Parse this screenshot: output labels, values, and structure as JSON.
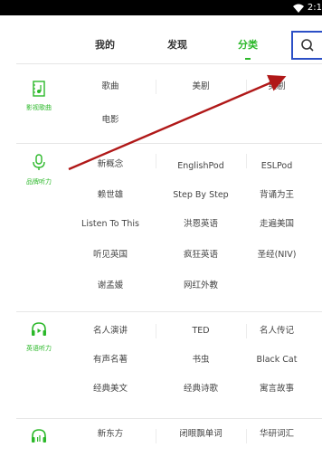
{
  "status": {
    "time": "2:1"
  },
  "tabs": [
    {
      "label": "我的"
    },
    {
      "label": "发现"
    },
    {
      "label": "分类"
    }
  ],
  "sections": [
    {
      "label": "影视歌曲",
      "icon": "film-music-icon",
      "items": [
        "歌曲",
        "美剧",
        "英剧",
        "电影"
      ]
    },
    {
      "label": "品牌听力",
      "icon": "microphone-icon",
      "items": [
        "新概念",
        "EnglishPod",
        "ESLPod",
        "赖世雄",
        "Step By Step",
        "背诵为王",
        "Listen To This",
        "洪恩英语",
        "走遍美国",
        "听见英国",
        "疯狂英语",
        "圣经(NIV)",
        "谢孟媛",
        "网红外教"
      ]
    },
    {
      "label": "英语听力",
      "icon": "headphone-play-icon",
      "items": [
        "名人演讲",
        "TED",
        "名人传记",
        "有声名著",
        "书虫",
        "Black Cat",
        "经典美文",
        "经典诗歌",
        "寓言故事"
      ]
    },
    {
      "label": "",
      "icon": "headphone-bars-icon",
      "items": [
        "新东方",
        "闭眼飘单词",
        "华研词汇"
      ]
    }
  ],
  "colors": {
    "accent": "#2bb829",
    "highlight_box": "#2b4fc6",
    "arrow": "#b01818"
  }
}
